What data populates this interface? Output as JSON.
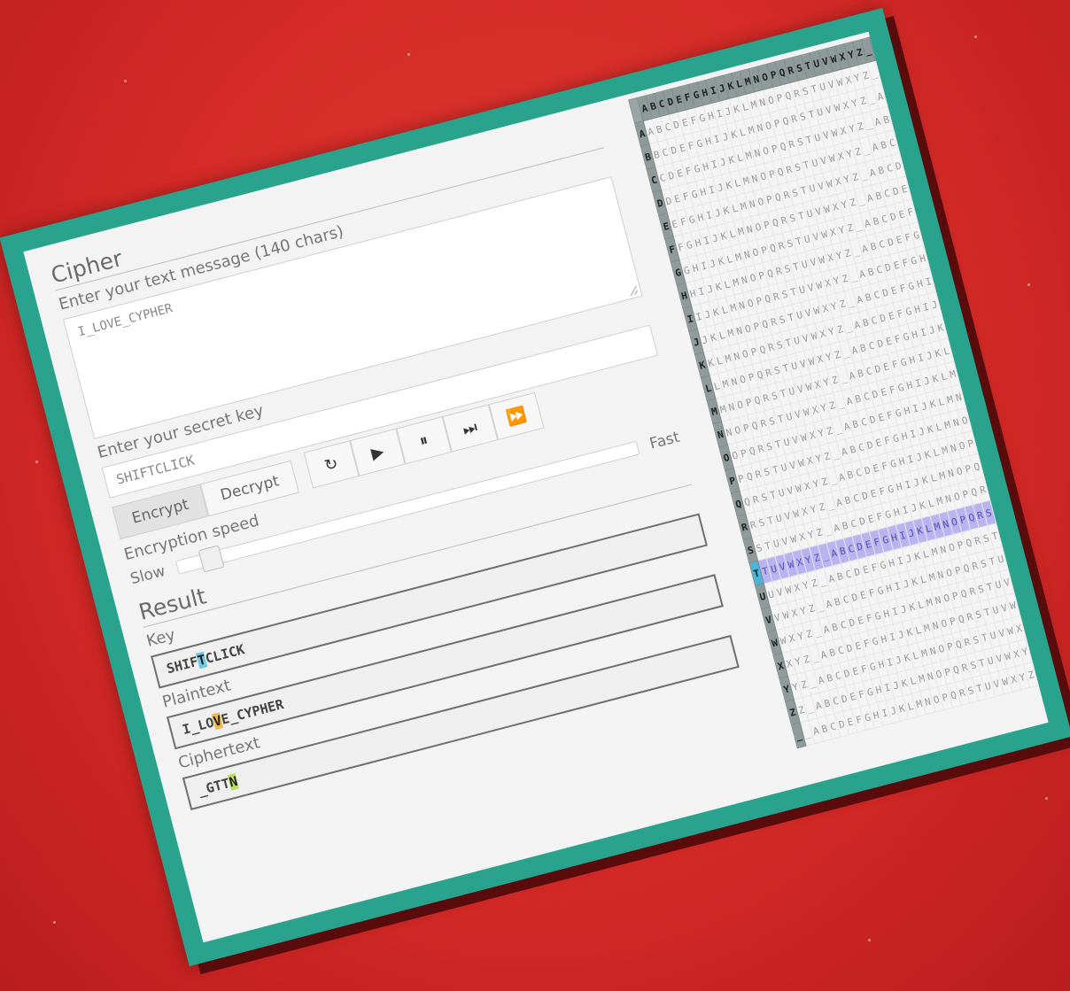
{
  "cipher": {
    "title": "Cipher",
    "message_label": "Enter your text message (140 chars)",
    "message_value": "I_LOVE_CYPHER",
    "key_label": "Enter your secret key",
    "key_value": "SHIFTCLICK",
    "encrypt_label": "Encrypt",
    "decrypt_label": "Decrypt",
    "speed_label": "Encryption speed",
    "slow_label": "Slow",
    "fast_label": "Fast",
    "speed_level": 0.05,
    "controls": [
      {
        "name": "reset-icon",
        "glyph": "↻"
      },
      {
        "name": "play-icon",
        "glyph": "▶"
      },
      {
        "name": "pause-icon",
        "glyph": "⏸"
      },
      {
        "name": "step-icon",
        "glyph": "⏭"
      },
      {
        "name": "fast-forward-icon",
        "glyph": "⏩"
      }
    ]
  },
  "result": {
    "title": "Result",
    "key_label": "Key",
    "key_pre": "SHIF",
    "key_hl": "T",
    "key_post": "CLICK",
    "plain_label": "Plaintext",
    "plain_pre": "I_LO",
    "plain_hl": "V",
    "plain_post": "E_CYPHER",
    "cipher_label": "Ciphertext",
    "cipher_pre": "_GTT",
    "cipher_hl": "N",
    "cipher_post": ""
  },
  "tabula": {
    "alphabet": "ABCDEFGHIJKLMNOPQRSTUVWXYZ_",
    "highlight_row": "T",
    "highlight_col": "V",
    "colors": {
      "row_header": "#4cb3d6",
      "row_cells": "#b9b3f2",
      "background": "#d52a27",
      "frame": "#2aa38e"
    }
  }
}
